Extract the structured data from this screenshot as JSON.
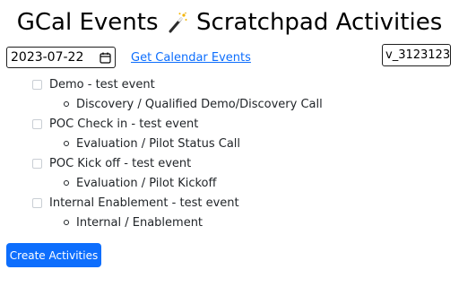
{
  "header": {
    "title_left": "GCal Events",
    "title_right": "Scratchpad Activities",
    "icon": "magic-wand-icon"
  },
  "controls": {
    "date_value": "2023-07-22",
    "date_icon": "calendar-icon",
    "get_events_label": "Get Calendar Events",
    "version_value": "v_3123123"
  },
  "events": [
    {
      "name": "Demo - test event",
      "activity": "Discovery / Qualified Demo/Discovery Call",
      "checked": false
    },
    {
      "name": "POC Check in - test event",
      "activity": "Evaluation / Pilot Status Call",
      "checked": false
    },
    {
      "name": "POC Kick off - test event",
      "activity": "Evaluation / Pilot Kickoff",
      "checked": false
    },
    {
      "name": "Internal Enablement - test event",
      "activity": "Internal / Enablement",
      "checked": false
    }
  ],
  "actions": {
    "create_label": "Create Activities",
    "create_color": "#0d6efd"
  }
}
